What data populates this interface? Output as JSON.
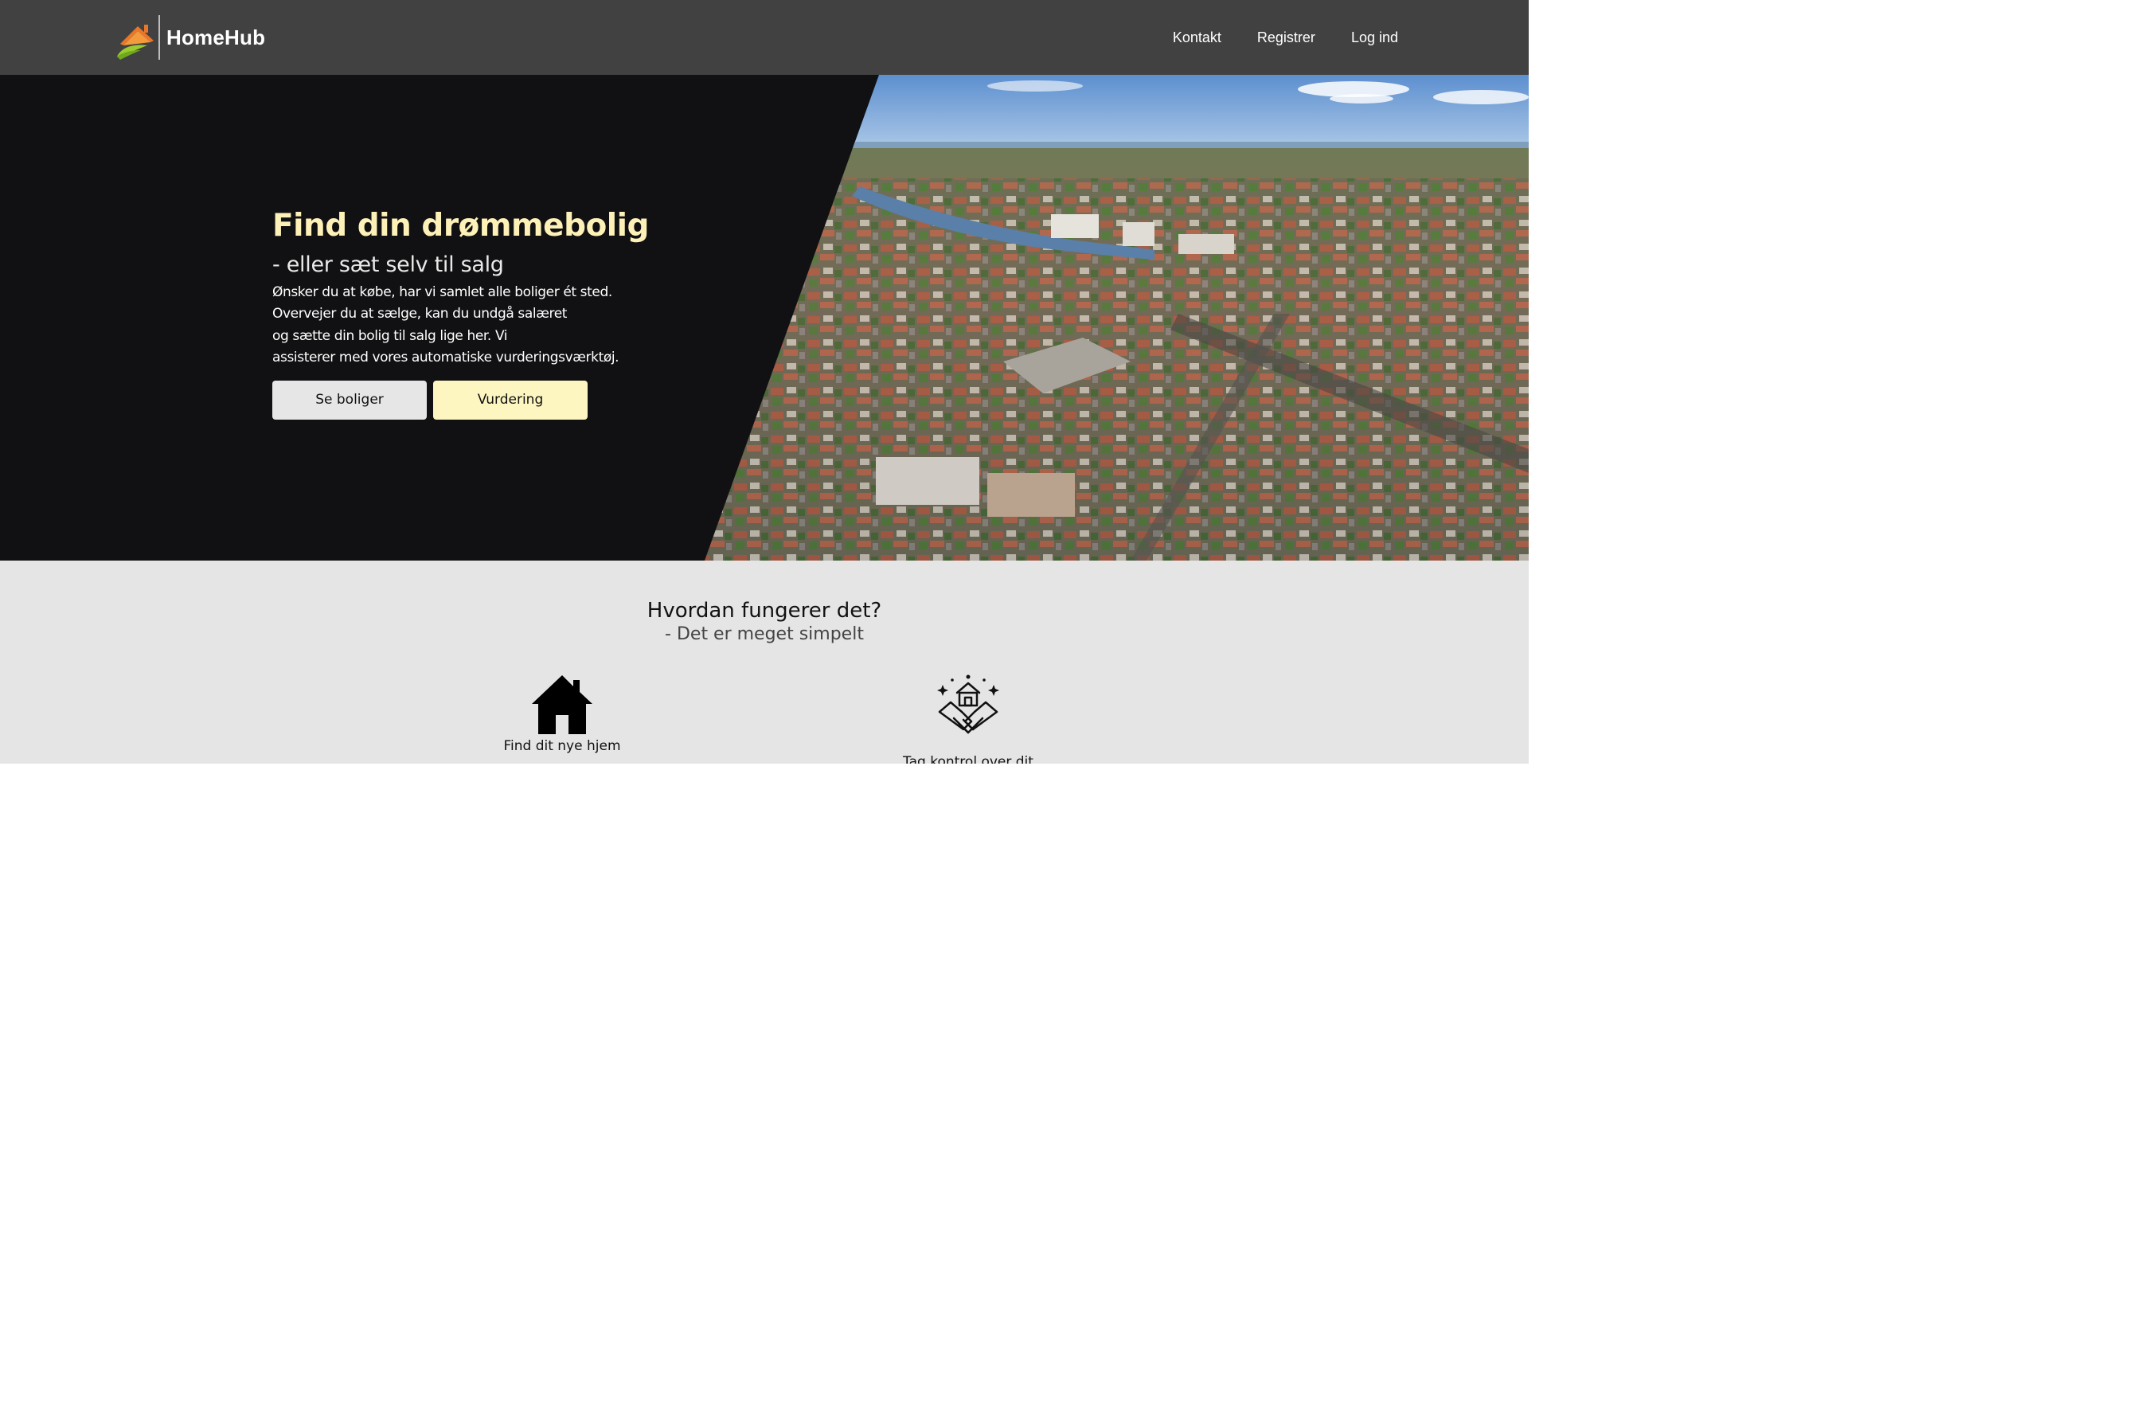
{
  "navbar": {
    "brand": "HomeHub",
    "links": [
      {
        "label": "Kontakt"
      },
      {
        "label": "Registrer"
      },
      {
        "label": "Log ind"
      }
    ]
  },
  "hero": {
    "title": "Find din drømmebolig",
    "subtitle": "- eller sæt selv til salg",
    "description_lines": [
      "Ønsker du at købe, har vi samlet alle boliger ét sted.",
      "Overvejer du at sælge, kan du undgå salæret",
      "og sætte din bolig til salg lige her. Vi",
      "assisterer med vores automatiske vurderingsværktøj."
    ],
    "buttons": {
      "primary": "Se boliger",
      "secondary": "Vurdering"
    }
  },
  "how_it_works": {
    "title": "Hvordan fungerer det?",
    "subtitle": "- Det er meget simpelt",
    "items": [
      {
        "label": "Find dit nye hjem",
        "icon": "house-icon"
      },
      {
        "label": "Tag kontrol over dit",
        "icon": "handshake-house-icon"
      }
    ]
  },
  "colors": {
    "navbar": "#414141",
    "hero_background": "#111113",
    "accent_yellow": "#fdf1b8",
    "section_background": "#e5e5e5"
  }
}
